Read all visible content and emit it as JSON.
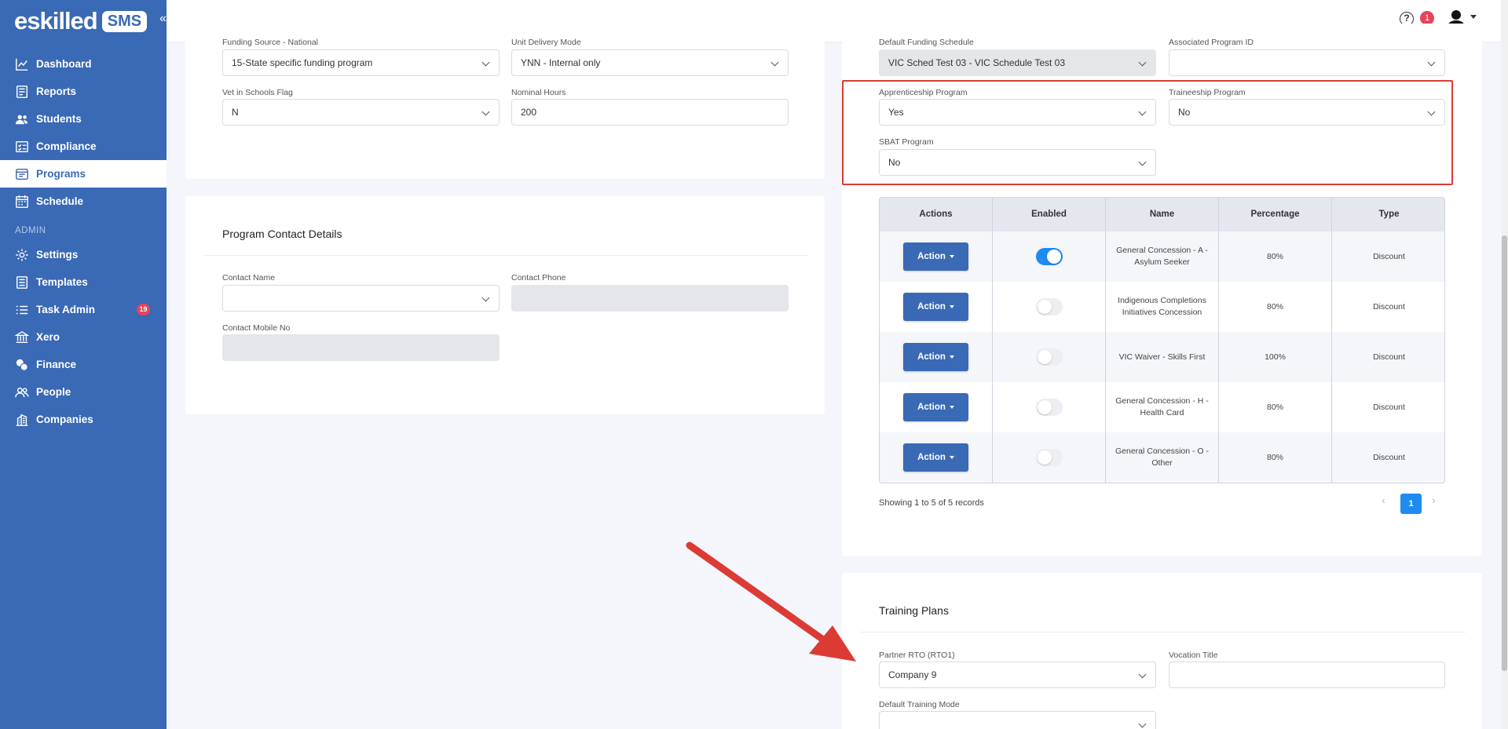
{
  "brand": {
    "logo_text": "eskilled",
    "badge": "SMS",
    "collapse": "«"
  },
  "sidebar": {
    "items": [
      {
        "label": "Dashboard",
        "icon": "chart-line-icon"
      },
      {
        "label": "Reports",
        "icon": "report-icon"
      },
      {
        "label": "Students",
        "icon": "users-icon"
      },
      {
        "label": "Compliance",
        "icon": "checklist-icon"
      },
      {
        "label": "Programs",
        "icon": "programs-icon",
        "active": true
      },
      {
        "label": "Schedule",
        "icon": "calendar-icon"
      }
    ],
    "admin_heading": "ADMIN",
    "admin_items": [
      {
        "label": "Settings",
        "icon": "gear-icon"
      },
      {
        "label": "Templates",
        "icon": "template-icon"
      },
      {
        "label": "Task Admin",
        "icon": "task-list-icon",
        "badge": "19"
      },
      {
        "label": "Xero",
        "icon": "bank-icon"
      },
      {
        "label": "Finance",
        "icon": "coins-icon"
      },
      {
        "label": "People",
        "icon": "people-icon"
      },
      {
        "label": "Companies",
        "icon": "building-icon"
      }
    ]
  },
  "topbar": {
    "help": "?",
    "notifications": "1"
  },
  "left_card": {
    "funding_source_label": "Funding Source - National",
    "funding_source_value": "15-State specific funding program",
    "unit_delivery_label": "Unit Delivery Mode",
    "unit_delivery_value": "YNN - Internal only",
    "vet_label": "Vet in Schools Flag",
    "vet_value": "N",
    "nominal_label": "Nominal Hours",
    "nominal_value": "200"
  },
  "contact_card": {
    "title": "Program Contact Details",
    "contact_name_label": "Contact Name",
    "contact_name_value": "",
    "contact_phone_label": "Contact Phone",
    "contact_phone_value": "",
    "contact_mobile_label": "Contact Mobile No",
    "contact_mobile_value": ""
  },
  "right_card": {
    "default_funding_label": "Default Funding Schedule",
    "default_funding_value": "VIC Sched Test 03 - VIC Schedule Test 03",
    "assoc_label": "Associated Program ID",
    "assoc_value": "",
    "apprenticeship_label": "Apprenticeship Program",
    "apprenticeship_value": "Yes",
    "traineeship_label": "Traineeship Program",
    "traineeship_value": "No",
    "sbat_label": "SBAT Program",
    "sbat_value": "No"
  },
  "concessions": {
    "headers": [
      "Actions",
      "Enabled",
      "Name",
      "Percentage",
      "Type"
    ],
    "action_label": "Action",
    "rows": [
      {
        "enabled": true,
        "name": "General Concession - A - Asylum Seeker",
        "percentage": "80%",
        "type": "Discount"
      },
      {
        "enabled": false,
        "name": "Indigenous Completions Initiatives Concession",
        "percentage": "80%",
        "type": "Discount"
      },
      {
        "enabled": false,
        "name": "VIC Waiver - Skills First",
        "percentage": "100%",
        "type": "Discount"
      },
      {
        "enabled": false,
        "name": "General Concession - H - Health Card",
        "percentage": "80%",
        "type": "Discount"
      },
      {
        "enabled": false,
        "name": "General Concession - O - Other",
        "percentage": "80%",
        "type": "Discount"
      }
    ],
    "footer": "Showing 1 to 5 of 5 records",
    "page": "1",
    "prev": "‹",
    "next": "›"
  },
  "training_plans": {
    "title": "Training Plans",
    "partner_label": "Partner RTO (RTO1)",
    "partner_value": "Company 9",
    "vocation_label": "Vocation Title",
    "vocation_value": "",
    "mode_label": "Default Training Mode",
    "mode_value": ""
  },
  "colors": {
    "primary": "#3a69b5",
    "accent": "#1e8bf0",
    "highlight": "#dc3b35",
    "badge": "#e8435a"
  }
}
